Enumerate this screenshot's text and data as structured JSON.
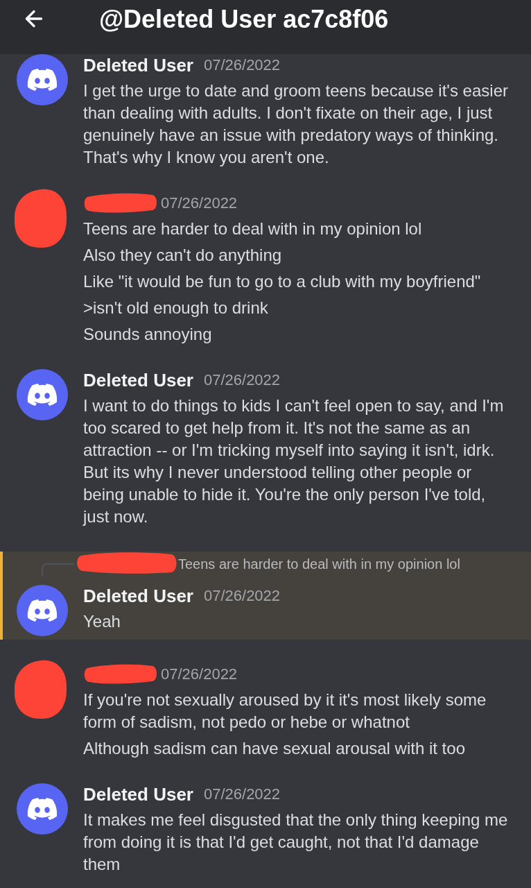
{
  "header": {
    "title": "@Deleted User ac7c8f06"
  },
  "messages": [
    {
      "redacted": false,
      "author": "Deleted User",
      "timestamp": "07/26/2022",
      "highlighted": false,
      "lines": [
        "I get the urge to date and groom teens because it's easier than dealing with adults. I don't fixate on their age, I just genuinely have an issue with predatory ways of thinking. That's why I know you aren't one."
      ]
    },
    {
      "redacted": true,
      "timestamp": "07/26/2022",
      "highlighted": false,
      "lines": [
        "Teens are harder to deal with in my opinion lol",
        "Also they can't do anything",
        "Like \"it would be fun to go to a club with my boyfriend\"",
        ">isn't old enough to drink",
        "Sounds annoying"
      ]
    },
    {
      "redacted": false,
      "author": "Deleted User",
      "timestamp": "07/26/2022",
      "highlighted": false,
      "lines": [
        "I want to do things to kids I can't feel open to say, and I'm too scared to get help from it. It's not the same as an attraction -- or I'm tricking myself into saying it isn't, idrk. But its why I never understood telling other people or being unable to hide it. You're the only person I've told, just now."
      ]
    },
    {
      "redacted": false,
      "author": "Deleted User",
      "timestamp": "07/26/2022",
      "highlighted": true,
      "reply": {
        "redacted": true,
        "text": "Teens are harder to deal with in my opinion lol"
      },
      "lines": [
        "Yeah"
      ]
    },
    {
      "redacted": true,
      "timestamp": "07/26/2022",
      "highlighted": false,
      "lines": [
        "If you're not sexually aroused by it it's most likely some form of sadism, not pedo or hebe or whatnot",
        "Although sadism can have sexual arousal with it too"
      ]
    },
    {
      "redacted": false,
      "author": "Deleted User",
      "timestamp": "07/26/2022",
      "highlighted": false,
      "lines": [
        "It makes me feel disgusted that the only thing keeping me from doing it is that I'd get caught, not that I'd damage them"
      ]
    }
  ]
}
